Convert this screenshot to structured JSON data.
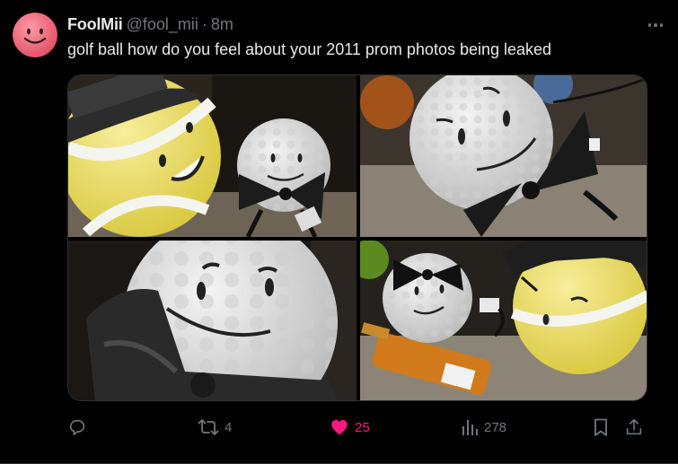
{
  "post": {
    "display_name": "FoolMii",
    "handle": "@fool_mii",
    "separator": "·",
    "time": "8m",
    "text": "golf ball how do you feel about your 2011 prom photos being leaked"
  },
  "media": {
    "images": [
      {
        "description_icon": "photo-tennis-ball-and-golf-ball"
      },
      {
        "description_icon": "photo-golf-ball-bowtie"
      },
      {
        "description_icon": "photo-golf-ball-closeup"
      },
      {
        "description_icon": "photo-golf-ball-bottle"
      }
    ]
  },
  "actions": {
    "reply_count": "",
    "retweet_count": "4",
    "like_count": "25",
    "view_count": "278",
    "like_color": "#f91880",
    "icon_color": "#71767b"
  },
  "colors": {
    "avatar_bg": "#f06a7a",
    "text": "#e7e9ea",
    "muted": "#71767b"
  }
}
